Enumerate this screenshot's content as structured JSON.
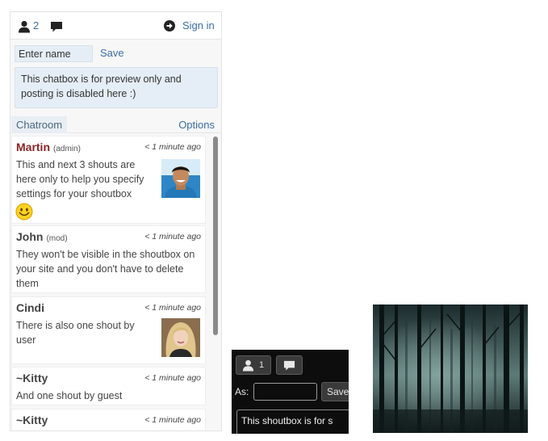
{
  "chatbox": {
    "online_count": "2",
    "signin_label": "Sign in",
    "name_placeholder": "Enter name",
    "save_label": "Save",
    "notice": "This chatbox is for preview only and posting is disabled here :)",
    "tab_label": "Chatroom",
    "options_label": "Options"
  },
  "messages": [
    {
      "author": "Martin",
      "role": "(admin)",
      "time": "< 1 minute ago",
      "text": "This and next 3 shouts are here only to help you specify settings for your shoutbox"
    },
    {
      "author": "John",
      "role": "(mod)",
      "time": "< 1 minute ago",
      "text": "They won't be visible in the shoutbox on your site and you don't have to delete them"
    },
    {
      "author": "Cindi",
      "role": "",
      "time": "< 1 minute ago",
      "text": "There is also one shout by user"
    },
    {
      "author": "~Kitty",
      "role": "",
      "time": "< 1 minute ago",
      "text": "And one shout by guest"
    },
    {
      "author": "~Kitty",
      "role": "",
      "time": "< 1 minute ago",
      "text": ""
    }
  ],
  "dark_preview": {
    "online_count": "1",
    "as_label": "As:",
    "save_label": "Save",
    "notice": "This shoutbox is for s"
  },
  "colors": {
    "link": "#3a6ea5",
    "admin_name": "#8a2326",
    "notice_bg": "#e5eef6",
    "dark_bg": "#0d0d0d"
  },
  "icons": [
    "user-icon",
    "chat-bubble-icon",
    "sign-in-arrow-icon",
    "smiley-icon"
  ]
}
